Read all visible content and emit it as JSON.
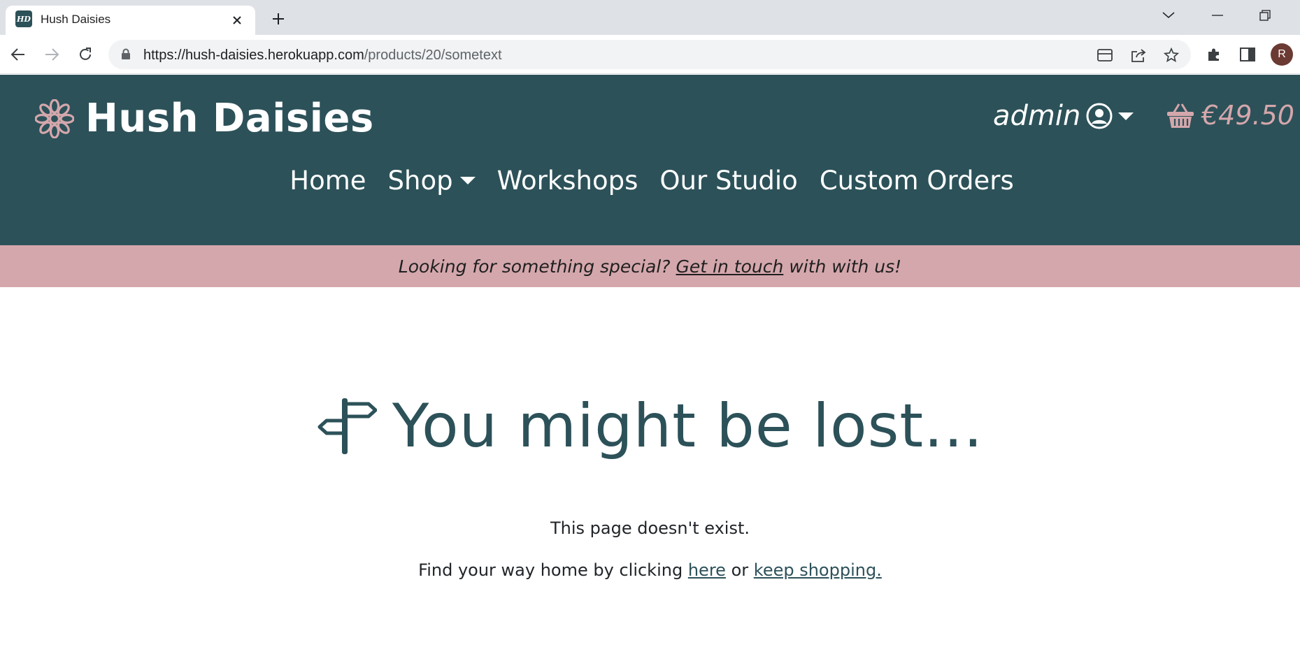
{
  "browser": {
    "tab_title": "Hush Daisies",
    "tab_favicon_text": "HD",
    "url_host": "https://hush-daisies.herokuapp.com",
    "url_path": "/products/20/sometext",
    "profile_initial": "R"
  },
  "header": {
    "brand": "Hush Daisies",
    "account_name": "admin",
    "basket_total": "€49.50",
    "nav": {
      "home": "Home",
      "shop": "Shop",
      "workshops": "Workshops",
      "studio": "Our Studio",
      "custom": "Custom Orders"
    }
  },
  "banner": {
    "prefix": "Looking for something special?",
    "link": "Get in touch",
    "suffix": "with with us!"
  },
  "main": {
    "title": "You might be lost...",
    "line1": "This page doesn't exist.",
    "line2_prefix": "Find your way home by clicking",
    "here_link": "here",
    "or_text": "or",
    "shop_link": "keep shopping."
  },
  "colors": {
    "brand_teal": "#2c5159",
    "accent_pink": "#d4a7ac"
  }
}
